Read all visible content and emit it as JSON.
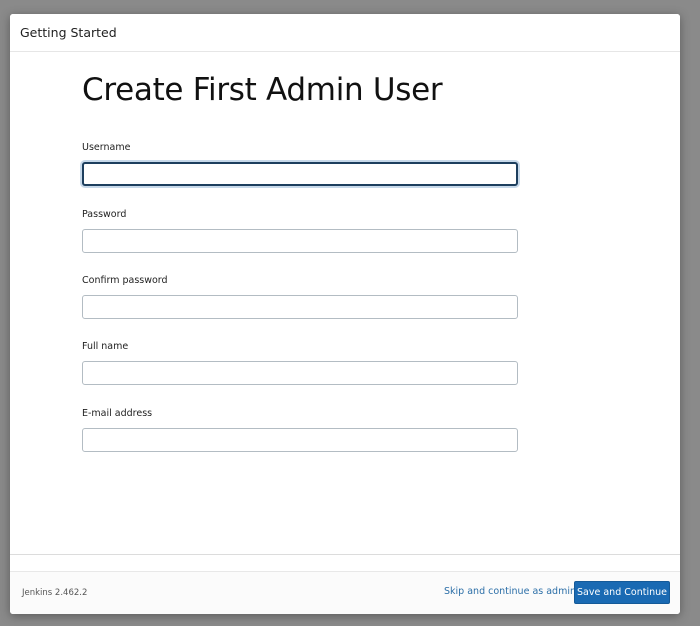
{
  "dialog": {
    "title": "Getting Started"
  },
  "form": {
    "title": "Create First Admin User",
    "fields": [
      {
        "label": "Username",
        "value": "",
        "focused": true
      },
      {
        "label": "Password",
        "value": ""
      },
      {
        "label": "Confirm password",
        "value": ""
      },
      {
        "label": "Full name",
        "value": ""
      },
      {
        "label": "E-mail address",
        "value": ""
      }
    ]
  },
  "footer": {
    "version": "Jenkins 2.462.2",
    "skip_label": "Skip and continue as admin",
    "save_label": "Save and Continue"
  },
  "colors": {
    "accent": "#1a6ab3",
    "link": "#2c6fa8",
    "focus_border": "#1d3f5e"
  }
}
